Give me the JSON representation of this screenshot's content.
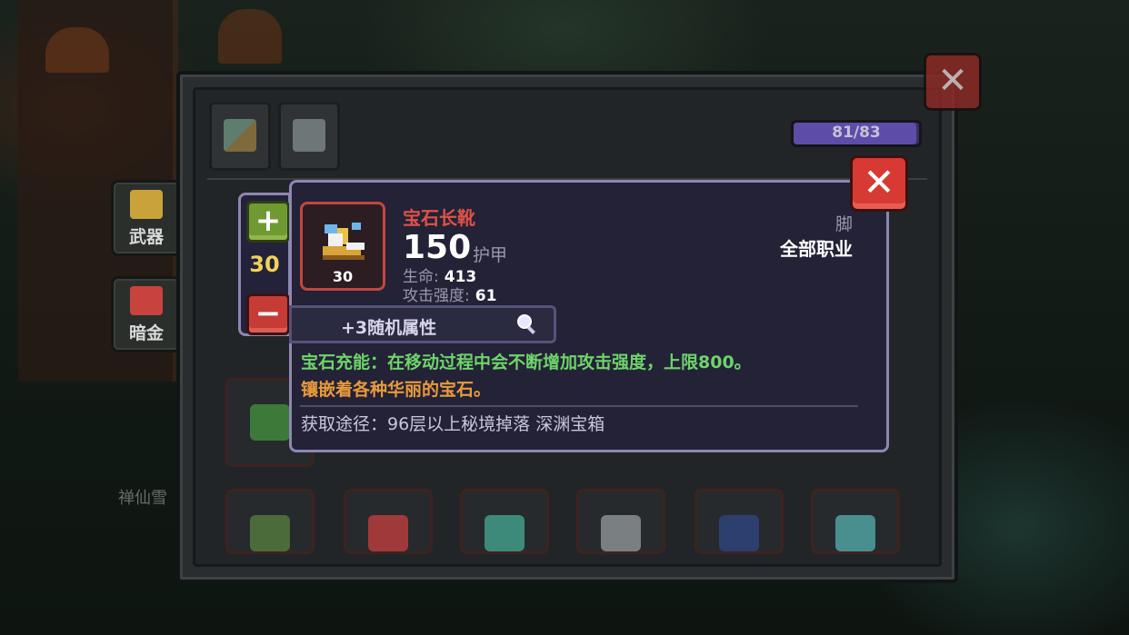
{
  "window": {
    "capacity_text": "81/83",
    "capacity_fraction": 0.976,
    "close_label": "✕"
  },
  "side_menu": {
    "items": [
      {
        "label": "武器",
        "color": "#c9a23a"
      },
      {
        "label": "暗金",
        "color": "#c8433d"
      }
    ],
    "ghost_label": "禅仙雪"
  },
  "tabs": [
    {
      "icon": "grid-icon",
      "color": "#6a8c7a"
    },
    {
      "icon": "armor-icon",
      "color": "#6f7677"
    }
  ],
  "tooltip": {
    "close_label": "✕",
    "quantity": {
      "value": "30",
      "plus_label": "+",
      "minus_label": "−"
    },
    "item": {
      "name": "宝石长靴",
      "level": "30",
      "armor_value": "150",
      "armor_label": "护甲",
      "stats": [
        {
          "label": "生命:",
          "value": "413"
        },
        {
          "label": "攻击强度:",
          "value": "61"
        }
      ],
      "slot": "脚",
      "class": "全部职业"
    },
    "random_attributes": "+3随机属性",
    "effect": "宝石充能：在移动过程中会不断增加攻击强度，上限800。",
    "flavor": "镶嵌着各种华丽的宝石。",
    "source": "获取途径：96层以上秘境掉落 深渊宝箱"
  },
  "inventory_slots": [
    {
      "icon": "potion-icon",
      "color": "#4b6b3a"
    },
    {
      "icon": "helmet-icon",
      "color": "#a03a3a"
    },
    {
      "icon": "gem-cluster-icon",
      "color": "#3d8a7a"
    },
    {
      "icon": "crystal-icon",
      "color": "#7a7f82"
    },
    {
      "icon": "robe-icon",
      "color": "#2c3f6e"
    },
    {
      "icon": "vest-icon",
      "color": "#4a8f8f"
    },
    {
      "icon": "amulet-icon",
      "color": "#3d7a3a"
    }
  ]
}
